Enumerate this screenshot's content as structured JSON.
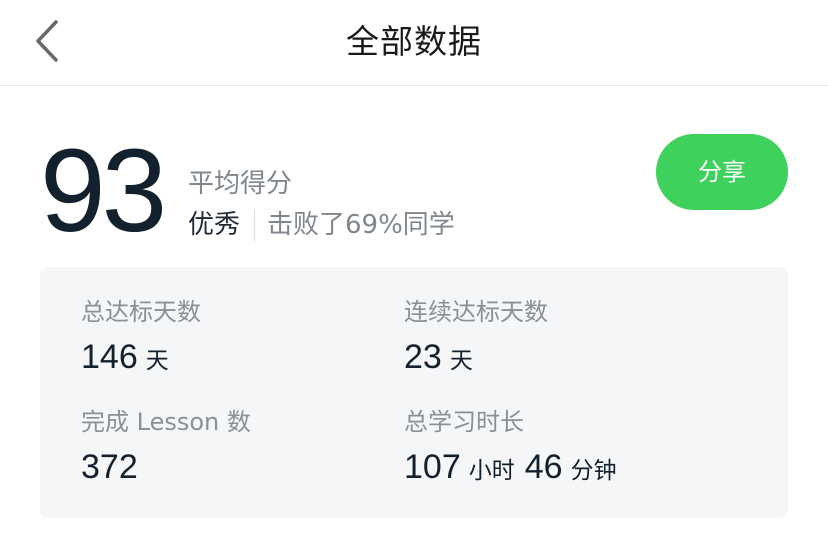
{
  "header": {
    "title": "全部数据",
    "back_icon": "chevron-left-icon"
  },
  "score": {
    "value": "93",
    "label": "平均得分",
    "rating": "优秀",
    "beat_text": "击败了69%同学"
  },
  "share": {
    "label": "分享",
    "color": "#3ED15C"
  },
  "stats": {
    "total_days": {
      "label": "总达标天数",
      "value": "146",
      "unit": "天"
    },
    "streak_days": {
      "label": "连续达标天数",
      "value": "23",
      "unit": "天"
    },
    "lessons": {
      "label": "完成 Lesson 数",
      "value": "372"
    },
    "study_time": {
      "label": "总学习时长",
      "hours": "107",
      "hours_unit": "小时",
      "minutes": "46",
      "minutes_unit": "分钟"
    }
  }
}
